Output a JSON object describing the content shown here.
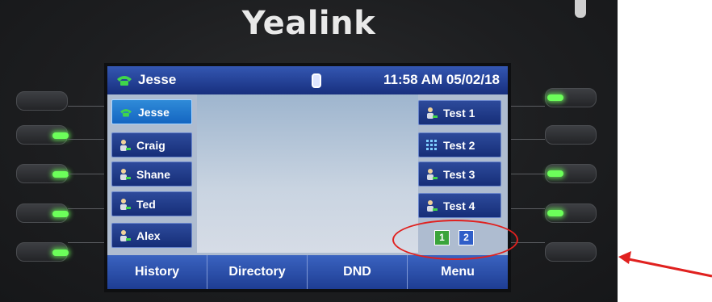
{
  "brand": "Yealink",
  "status": {
    "line_name": "Jesse",
    "time": "11:58 AM 05/02/18"
  },
  "left_keys": [
    {
      "label": "Jesse",
      "icon": "phone-icon",
      "active": true
    },
    {
      "label": "Craig",
      "icon": "contact-icon",
      "active": false
    },
    {
      "label": "Shane",
      "icon": "contact-icon",
      "active": false
    },
    {
      "label": "Ted",
      "icon": "contact-icon",
      "active": false
    },
    {
      "label": "Alex",
      "icon": "contact-icon",
      "active": false
    }
  ],
  "right_keys": [
    {
      "label": "Test 1",
      "icon": "contact-icon"
    },
    {
      "label": "Test 2",
      "icon": "keypad-icon"
    },
    {
      "label": "Test 3",
      "icon": "contact-icon"
    },
    {
      "label": "Test 4",
      "icon": "contact-icon"
    }
  ],
  "pages": [
    {
      "label": "1",
      "color": "#3aa43a"
    },
    {
      "label": "2",
      "color": "#2f5ec8"
    }
  ],
  "softkeys": [
    "History",
    "Directory",
    "DND",
    "Menu"
  ],
  "colors": {
    "led": "#6cff5a",
    "annotation": "#e0211f",
    "statusbar": "#1f3d8f"
  }
}
